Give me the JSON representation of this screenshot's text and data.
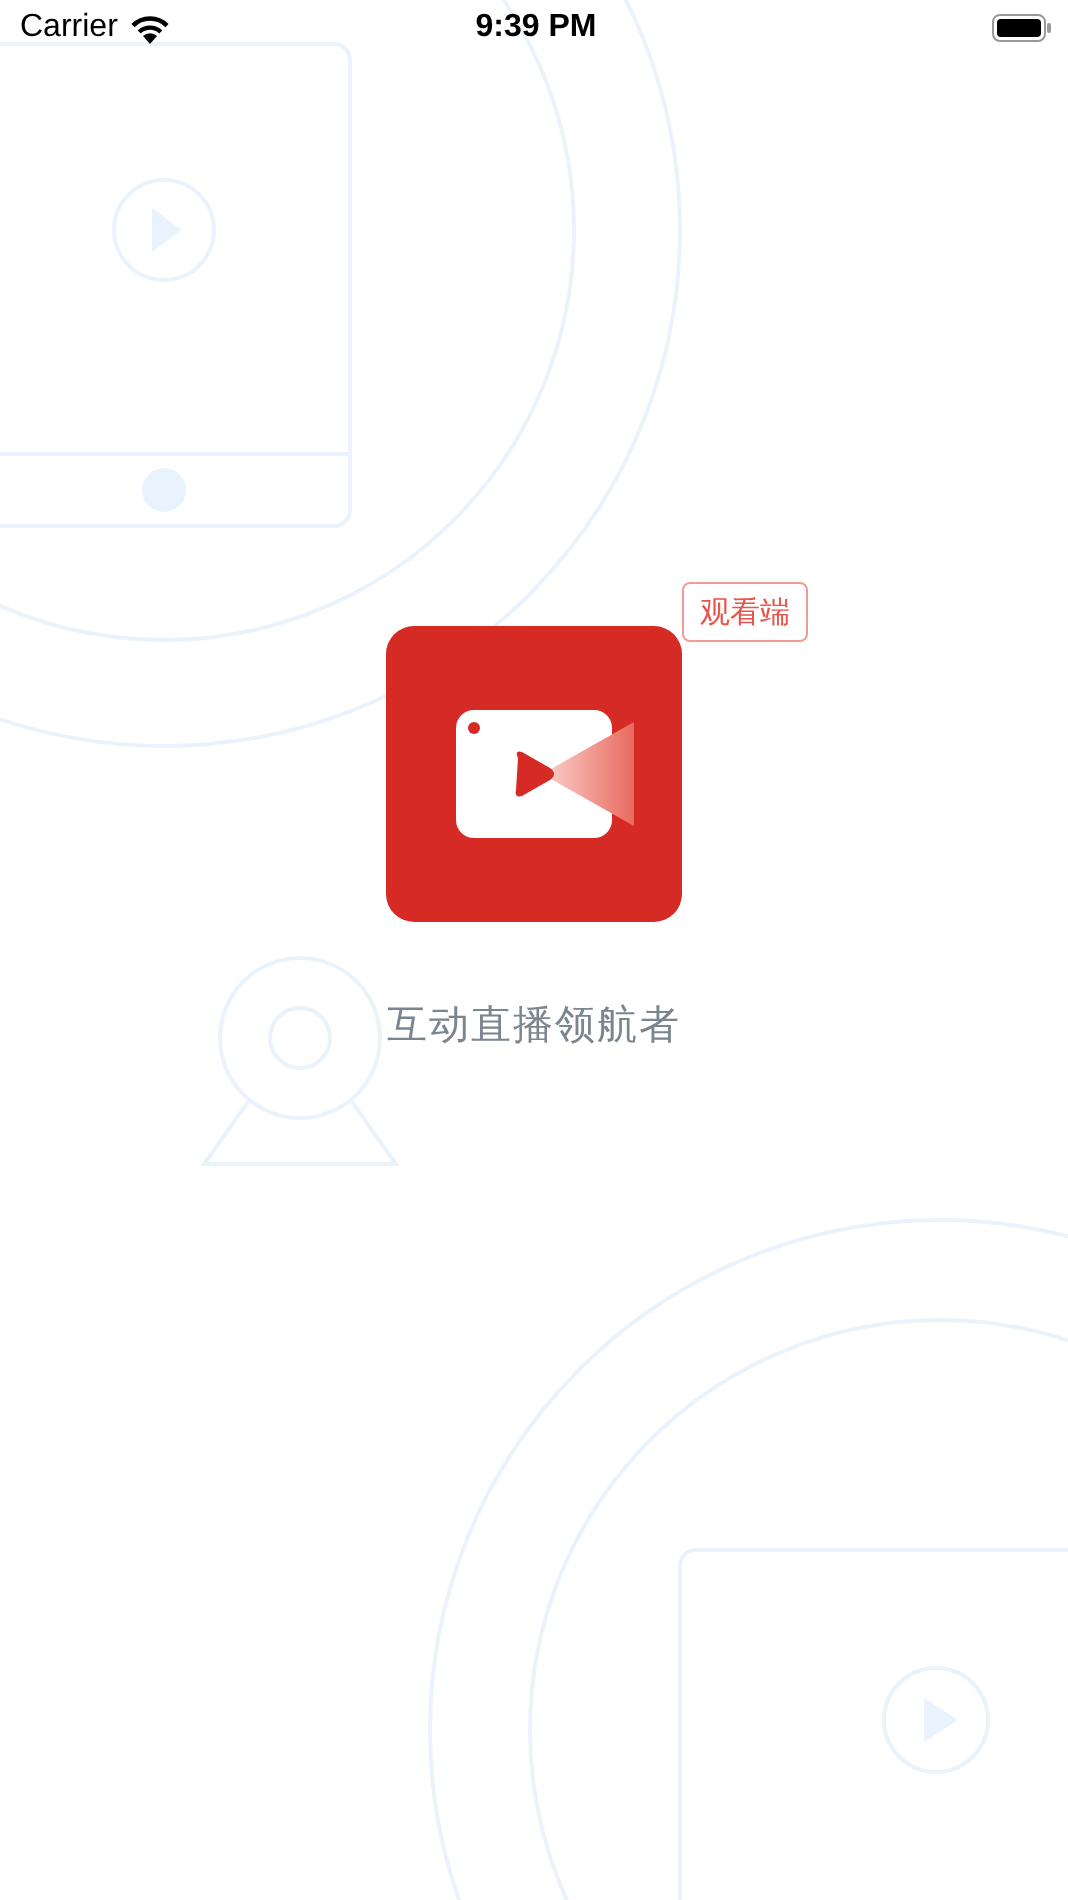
{
  "status_bar": {
    "carrier": "Carrier",
    "time": "9:39 PM"
  },
  "app_logo": {
    "badge": "观看端"
  },
  "slogan": "互动直播领航者"
}
